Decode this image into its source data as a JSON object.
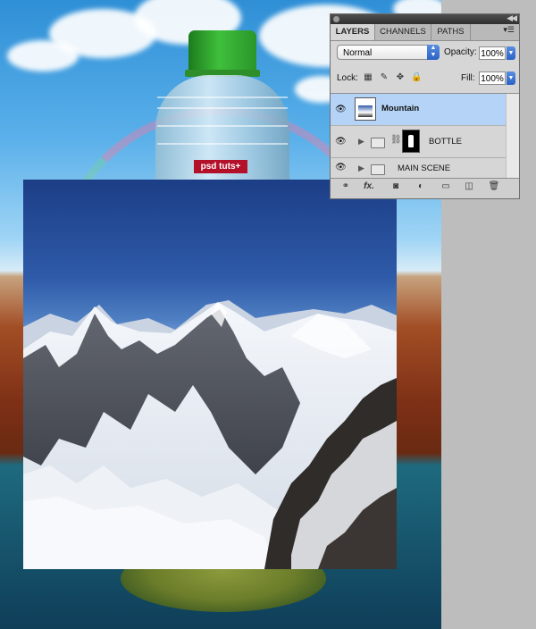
{
  "canvas": {
    "bottle_label": "psd tuts+"
  },
  "layers_panel": {
    "tabs": [
      "LAYERS",
      "CHANNELS",
      "PATHS"
    ],
    "active_tab": "LAYERS",
    "blend_mode": "Normal",
    "opacity_label": "Opacity:",
    "opacity_value": "100%",
    "lock_label": "Lock:",
    "fill_label": "Fill:",
    "fill_value": "100%",
    "layers": [
      {
        "name": "Mountain",
        "selected": true,
        "type": "layer",
        "visible": true
      },
      {
        "name": "BOTTLE",
        "selected": false,
        "type": "group-with-mask",
        "visible": true
      },
      {
        "name": "MAIN SCENE",
        "selected": false,
        "type": "group",
        "visible": true
      }
    ],
    "bottom_icons": [
      "link-icon",
      "fx-icon",
      "mask-icon",
      "adjustment-icon",
      "folder-icon",
      "new-layer-icon",
      "trash-icon"
    ],
    "bottom_fx_label": "fx."
  },
  "colors": {
    "selection": "#b5d3f7",
    "accent_blue": "#2b61c4"
  }
}
